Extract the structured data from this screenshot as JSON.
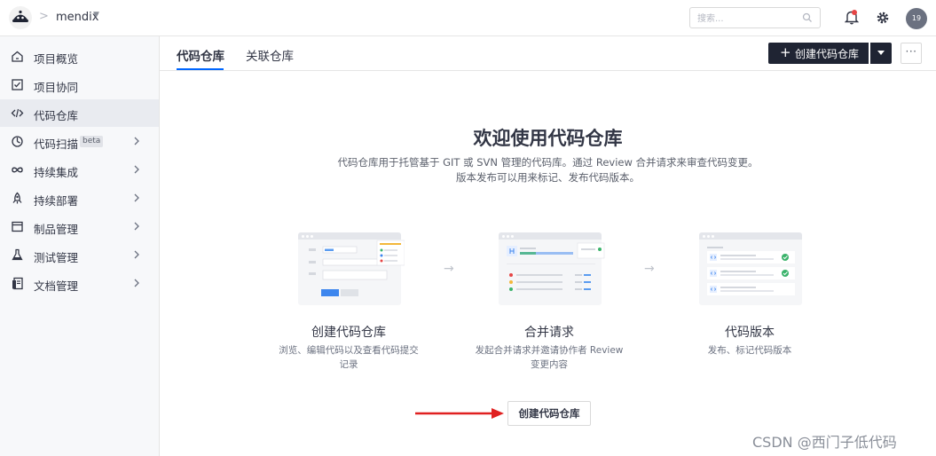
{
  "header": {
    "project_name": "mendix",
    "search_placeholder": "搜索...",
    "avatar_text": "19"
  },
  "sidebar": {
    "items": [
      {
        "label": "项目概览",
        "icon": "home-icon"
      },
      {
        "label": "项目协同",
        "icon": "checkbox-icon"
      },
      {
        "label": "代码仓库",
        "icon": "code-icon",
        "active": true
      },
      {
        "label": "代码扫描",
        "icon": "scan-icon",
        "badge": "beta",
        "has_children": true
      },
      {
        "label": "持续集成",
        "icon": "infinity-icon",
        "has_children": true
      },
      {
        "label": "持续部署",
        "icon": "rocket-icon",
        "has_children": true
      },
      {
        "label": "制品管理",
        "icon": "package-icon",
        "has_children": true
      },
      {
        "label": "测试管理",
        "icon": "flask-icon",
        "has_children": true
      },
      {
        "label": "文档管理",
        "icon": "book-icon",
        "has_children": true
      }
    ]
  },
  "tabs": [
    {
      "label": "代码仓库",
      "active": true
    },
    {
      "label": "关联仓库",
      "active": false
    }
  ],
  "toolbar": {
    "create_label": "创建代码仓库",
    "more_label": "···"
  },
  "welcome": {
    "title": "欢迎使用代码仓库",
    "desc_line1": "代码仓库用于托管基于 GIT 或 SVN 管理的代码库。通过 Review 合并请求来审查代码变更。",
    "desc_line2": "版本发布可以用来标记、发布代码版本。"
  },
  "steps": [
    {
      "title": "创建代码仓库",
      "desc_line1": "浏览、编辑代码以及查看代码提交",
      "desc_line2": "记录"
    },
    {
      "title": "合并请求",
      "desc_line1": "发起合并请求并邀请协作者 Review",
      "desc_line2": "变更内容"
    },
    {
      "title": "代码版本",
      "desc_line1": "发布、标记代码版本",
      "desc_line2": ""
    }
  ],
  "cta_label": "创建代码仓库",
  "watermark": "CSDN @西门子低代码",
  "colors": {
    "accent": "#0066ff",
    "dark_button": "#1f2433",
    "annotation_arrow": "#e02020",
    "notification_dot": "#e64545",
    "success": "#3bb36b"
  }
}
